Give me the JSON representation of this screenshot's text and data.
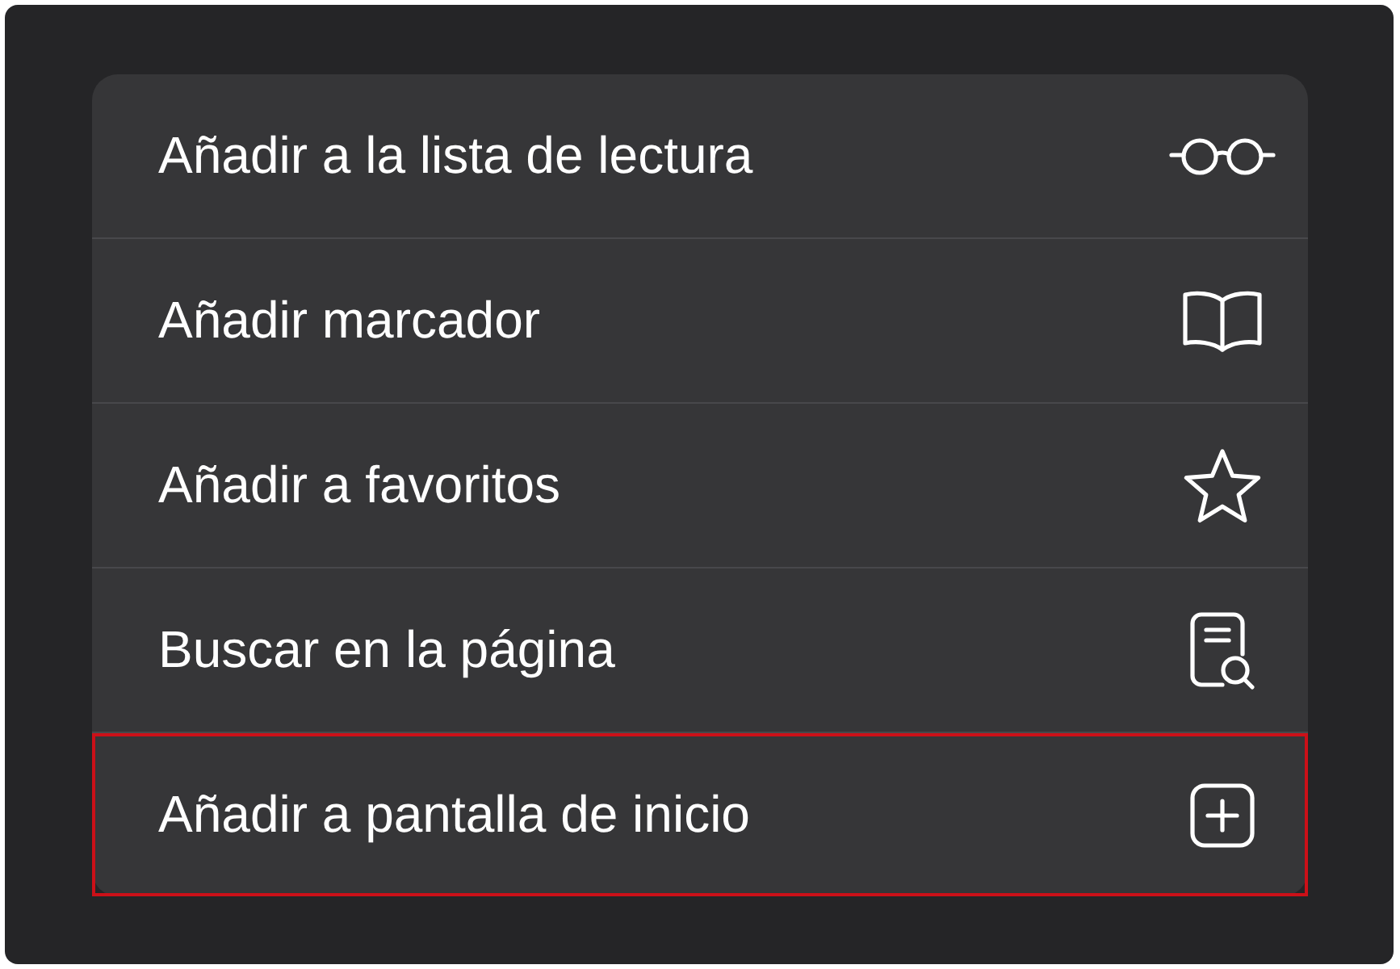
{
  "menu": {
    "items": [
      {
        "label": "Añadir a la lista de lectura",
        "highlighted": false
      },
      {
        "label": "Añadir marcador",
        "highlighted": false
      },
      {
        "label": "Añadir a favoritos",
        "highlighted": false
      },
      {
        "label": "Buscar en la página",
        "highlighted": false
      },
      {
        "label": "Añadir a pantalla de inicio",
        "highlighted": true
      }
    ]
  }
}
